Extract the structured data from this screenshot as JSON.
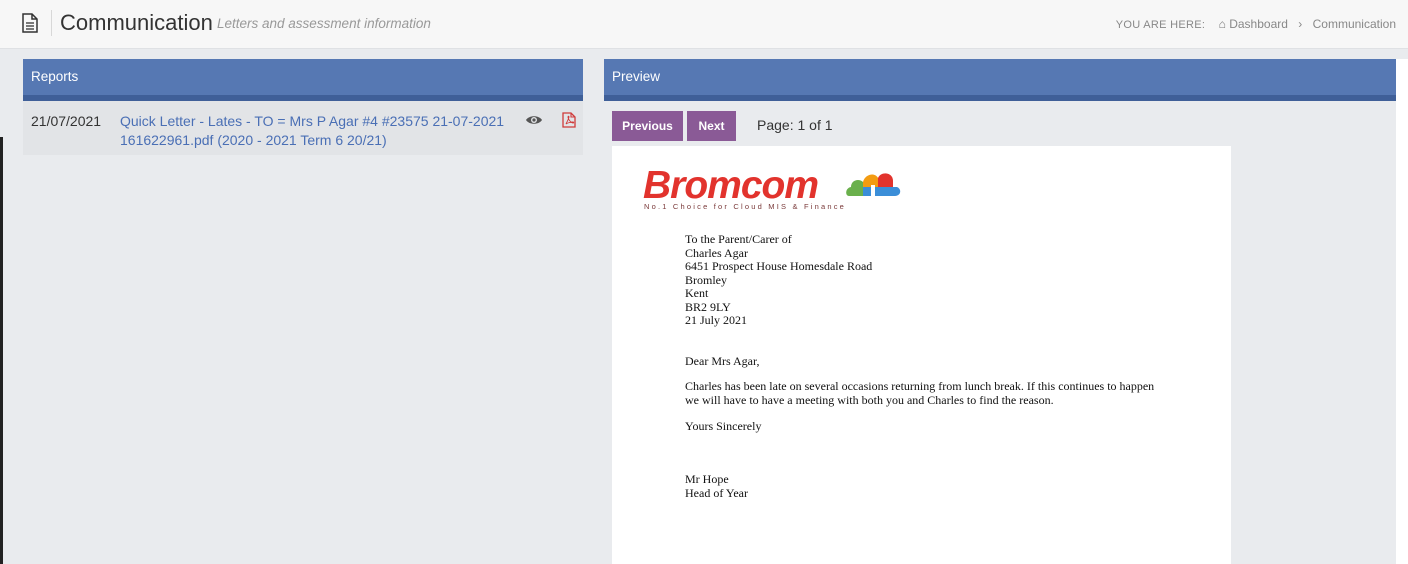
{
  "header": {
    "title": "Communication",
    "subtitle": "Letters and assessment information",
    "breadcrumb": {
      "label": "YOU ARE HERE:",
      "items": [
        "Dashboard",
        "Communication"
      ]
    }
  },
  "reports": {
    "heading": "Reports",
    "rows": [
      {
        "date": "21/07/2021",
        "name": "Quick Letter - Lates - TO = Mrs P Agar #4 #23575 21-07-2021 161622961.pdf (2020 - 2021 Term 6 20/21)"
      }
    ]
  },
  "preview": {
    "heading": "Preview",
    "previous_label": "Previous",
    "next_label": "Next",
    "page_indicator": "Page: 1 of 1",
    "document": {
      "brand": "Bromcom",
      "tagline": "No.1 Choice for Cloud MIS & Finance",
      "address": [
        "To the Parent/Carer of",
        "Charles Agar",
        "6451 Prospect House Homesdale Road",
        "Bromley",
        "Kent",
        "BR2 9LY",
        "21 July 2021"
      ],
      "salutation": "Dear Mrs Agar,",
      "body": "Charles has been late on several occasions returning from lunch break. If this continues to happen we will have to have a meeting with both you and Charles to find the reason.",
      "closing": "Yours Sincerely",
      "signatory_name": "Mr Hope",
      "signatory_title": "Head of Year"
    }
  },
  "colors": {
    "panel_header": "#5678b3",
    "button": "#8a5a96",
    "link": "#4a6fb5",
    "brand_red": "#e2332d"
  },
  "icons": [
    "document-icon",
    "home-icon",
    "eye-icon",
    "pdf-icon",
    "cloud-logo-icon"
  ]
}
